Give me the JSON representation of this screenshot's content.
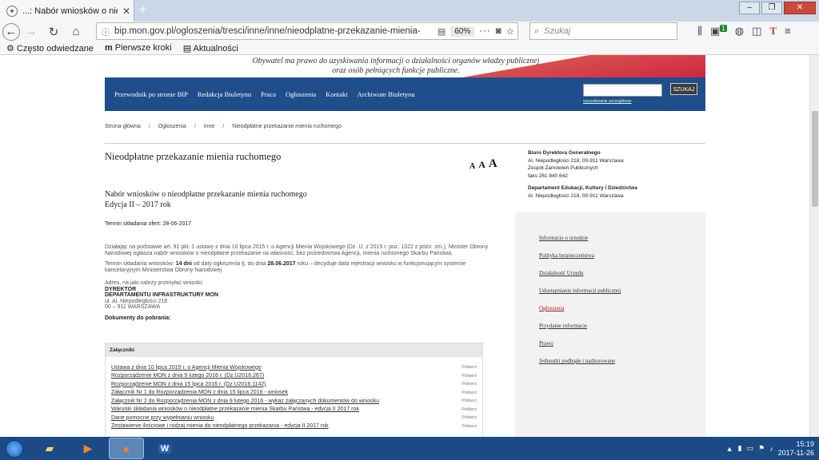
{
  "browser": {
    "tab_title": "...: Nabór wniosków o nieodpłat",
    "url": "bip.mon.gov.pl/ogloszenia/tresci/inne/inne/nieodplatne-przekazanie-mienia-",
    "zoom": "60%",
    "search_placeholder": "Szukaj",
    "toolbar_badge": "1",
    "bookmarks": [
      "Często odwiedzane",
      "Pierwsze kroki",
      "Aktualności"
    ]
  },
  "header": {
    "motto_line1": "Obywatel ma prawo do uzyskiwania informacji o działalności organów władzy publicznej",
    "motto_line2": "oraz osób pełniących funkcje publiczne.",
    "nav": [
      "Przewodnik po stronie BIP",
      "Redakcja Biuletynu",
      "Praca",
      "Ogłoszenia",
      "Kontakt",
      "Archiwum Biuletynu"
    ],
    "search_button": "SZUKAJ",
    "advanced_search": "wyszukiwanie szczegółowe"
  },
  "breadcrumb": [
    "Strona główna",
    "Ogłoszenia",
    "Inne",
    "Nieodpłatne przekazanie mienia ruchomego"
  ],
  "main": {
    "title": "Nieodpłatne przekazanie mienia ruchomego",
    "font_sizes": [
      "A",
      "A",
      "A"
    ],
    "subtitle_line1": "Nabór wniosków o nieodpłatne przekazanie mienia ruchomego",
    "subtitle_line2": "Edycja II – 2017 rok",
    "deadline": "Termin składania ofert: 28-06-2017",
    "para1": "Działając na podstawie art. 91 pkt. 1 ustawy z dnia 10 lipca 2015 r. o Agencji Mienia Wojskowego (Dz. U. z 2015 r. poz. 1322 z późn. zm.), Minister Obrony Narodowej ogłasza nabór wniosków o nieodpłatne przekazanie na własność, bez pośrednictwa Agencji, mienia ruchomego Skarbu Państwa.",
    "para2_pre": "Termin składania wniosków: ",
    "para2_b1": "14 dni",
    "para2_mid": " od daty ogłoszenia tj. do dnia ",
    "para2_b2": "28.06.2017",
    "para2_post": " roku – decyduje data rejestracji wniosku w funkcjonującym systemie kancelaryjnym Ministerstwa Obrony Narodowej.",
    "address_intro": "Adres, na jaki należy przesyłać wnioski:",
    "address_b1": "DYREKTOR",
    "address_b2": "DEPARTAMENTU INFRASTRUKTURY MON",
    "address_l1": "ul. Al. Niepodległości 218",
    "address_l2": "00 – 911 WARSZAWA",
    "docs_heading": "Dokumenty do pobrania:",
    "attachments_heading": "Załączniki",
    "download_label": "Pobierz",
    "attachments": [
      "Ustawa z dnia 10 lipca 2015 r. o Agencji Mienia Wojskowego",
      "Rozporządzenie MON z dnia 9 lutego 2016 r. (Dz.U2016.267)",
      "Rozporządzenie MON z dnia 15 lipca 2016 r. (Dz.U2016.1142)",
      "Załącznik Nr 1 do Rozporządzenia MON z dnia 15 lipca 2016 - wniosek",
      "Załącznik Nr 2 do Rozporządzenia MON z dnia 9 lutego 2016 - wykaz załączanych dokumentów do wniosku",
      "Warunki składania wniosków o nieodpłatne przekazanie mienia Skarbu Państwa - edycja II 2017 rok",
      "Dane pomocne przy wypełnianiu wniosku",
      "Zestawienie ilościowe i rodzaj mienia do nieodpłatnego przekazania - edycja II 2017 rok"
    ]
  },
  "contacts": {
    "org1": "Biuro Dyrektora Generalnego",
    "org1_addr": "Al. Niepodległości 218, 00-911 Warszawa",
    "org1_team": "Zespół Zamówień Publicznych",
    "org1_fax": "faks 261 840 642",
    "org2": "Departament Edukacji, Kultury i Dziedzictwa",
    "org2_addr": "Al. Niepodległości 218, 00-911 Warszawa"
  },
  "side_menu": [
    "Informacje o urzędzie",
    "Polityka bezpieczeństwa",
    "Działalność Urzędu",
    "Udostępnianie informacji publicznej",
    "Ogłoszenia",
    "Przydatne informacje",
    "Prawo",
    "Jednostki podległe i nadzorowane"
  ],
  "taskbar": {
    "time": "15:19",
    "date": "2017-11-26"
  }
}
